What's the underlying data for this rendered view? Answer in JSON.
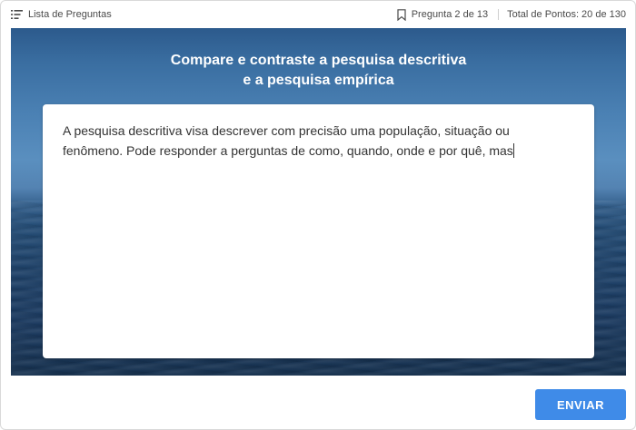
{
  "header": {
    "question_list_label": "Lista de Preguntas",
    "question_counter": "Pregunta 2 de 13",
    "total_points": "Total de Pontos: 20 de 130"
  },
  "question": {
    "title_line1": "Compare e contraste a pesquisa descritiva",
    "title_line2": "e a pesquisa empírica"
  },
  "answer": {
    "text": "A pesquisa descritiva visa descrever com precisão uma população, situação ou fenômeno. Pode responder a perguntas de como, quando, onde e por quê, mas"
  },
  "footer": {
    "submit_label": "ENVIAR"
  },
  "colors": {
    "accent": "#3f8be8"
  },
  "icons": {
    "question_list": "list-icon",
    "bookmark": "bookmark-icon"
  }
}
